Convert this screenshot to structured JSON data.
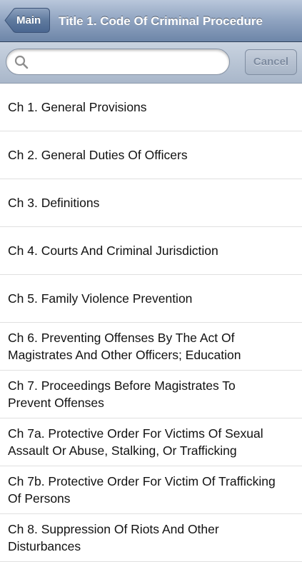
{
  "navbar": {
    "back_label": "Main",
    "title": "Title 1. Code Of Criminal Procedure"
  },
  "search": {
    "placeholder": "",
    "value": "",
    "cancel_label": "Cancel",
    "icon": "search-icon"
  },
  "chapters": [
    {
      "label": "Ch 1. General Provisions"
    },
    {
      "label": "Ch 2. General Duties Of Officers"
    },
    {
      "label": "Ch 3. Definitions"
    },
    {
      "label": "Ch 4. Courts And Criminal Jurisdiction"
    },
    {
      "label": "Ch 5. Family Violence Prevention"
    },
    {
      "label": "Ch 6. Preventing Offenses By The Act Of Magistrates And Other Officers; Education"
    },
    {
      "label": "Ch 7. Proceedings Before Magistrates To Prevent Offenses"
    },
    {
      "label": "Ch 7a. Protective Order For Victims Of Sexual Assault Or Abuse, Stalking, Or Trafficking"
    },
    {
      "label": "Ch 7b. Protective Order For Victim Of Trafficking Of Persons"
    },
    {
      "label": "Ch 8. Suppression Of Riots And Other Disturbances"
    }
  ]
}
